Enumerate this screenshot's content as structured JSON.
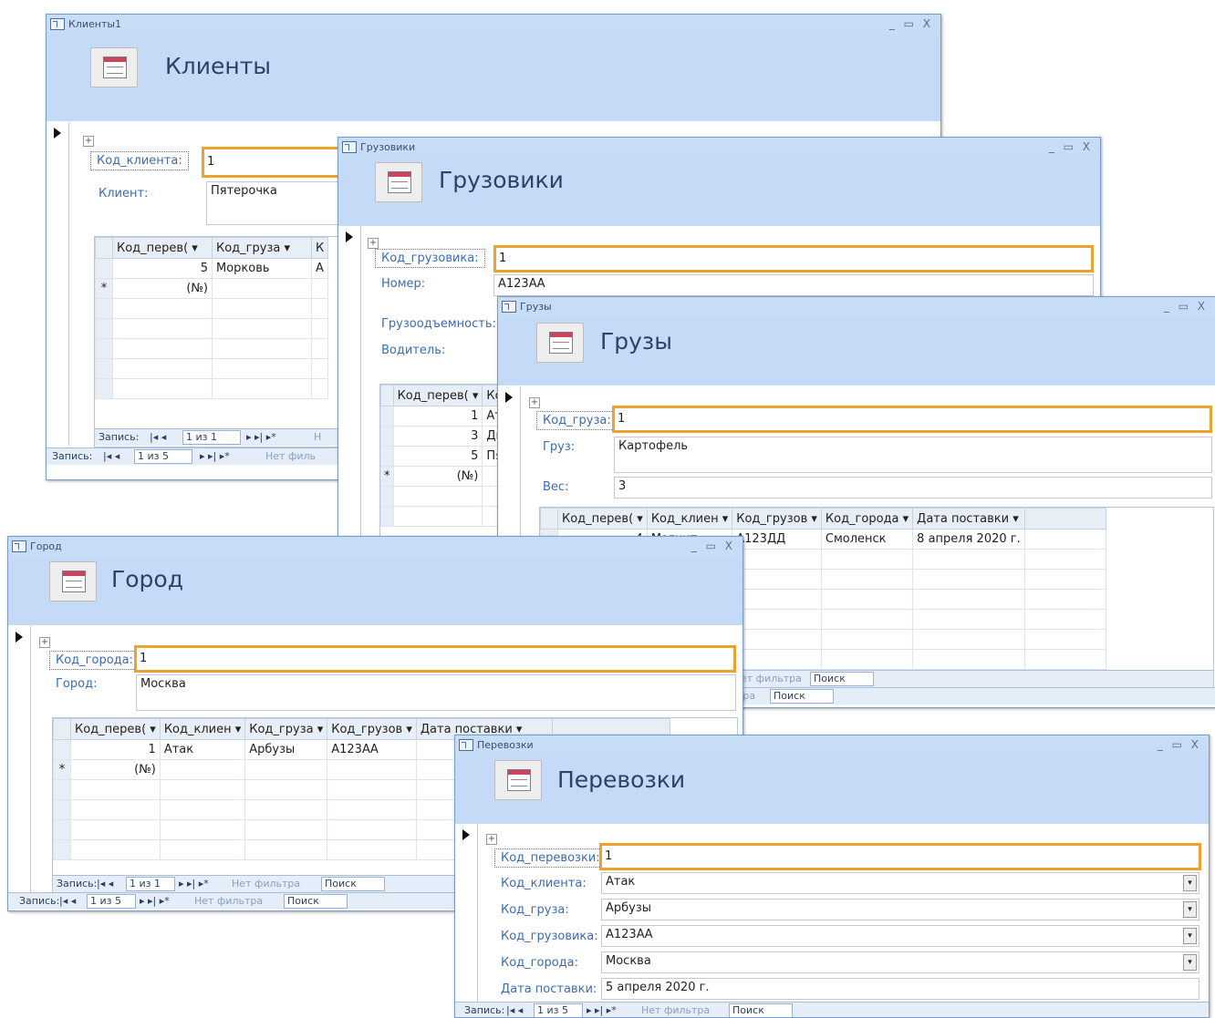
{
  "clients": {
    "title": "Клиенты1",
    "header": "Клиенты",
    "controls": "_ ▭ X",
    "fields": {
      "code_label": "Код_клиента:",
      "code_value": "1",
      "client_label": "Клиент:",
      "client_value": "Пятерочка"
    },
    "grid": {
      "headers": [
        "Код_перев( ▾",
        "Код_груза ▾",
        "К"
      ],
      "rows": [
        [
          "5",
          "Морковь",
          "А"
        ]
      ],
      "new_row": [
        "*",
        "(№)"
      ]
    },
    "inner_nav": {
      "label": "Запись:",
      "record": "1 из 1",
      "filter": "Н"
    },
    "outer_nav": {
      "label": "Запись:",
      "record": "1 из 5",
      "filter": "Нет филь"
    }
  },
  "trucks": {
    "title": "Грузовики",
    "header": "Грузовики",
    "controls": "_ ▭ X",
    "fields": {
      "code_label": "Код_грузовика:",
      "code_value": "1",
      "number_label": "Номер:",
      "number_value": "А123АА",
      "capacity_label": "Грузоодъемность:",
      "driver_label": "Водитель:"
    },
    "grid": {
      "headers": [
        "Код_перев( ▾",
        "Ко"
      ],
      "rows": [
        [
          "1",
          "Ат"
        ],
        [
          "3",
          "Ди"
        ],
        [
          "5",
          "Пя"
        ]
      ],
      "new_row": [
        "*",
        "(№)"
      ]
    }
  },
  "cargo": {
    "title": "Грузы",
    "header": "Грузы",
    "controls": "_ ▭ X",
    "fields": {
      "code_label": "Код_груза:",
      "code_value": "1",
      "cargo_label": "Груз:",
      "cargo_value": "Картофель",
      "weight_label": "Вес:",
      "weight_value": "3"
    },
    "grid": {
      "headers": [
        "Код_перев( ▾",
        "Код_клиен ▾",
        "Код_грузов ▾",
        "Код_города ▾",
        "Дата поставки ▾"
      ],
      "rows": [
        [
          "4",
          "Магнит",
          "А123ДД",
          "Смоленск",
          "8 апреля 2020 г."
        ]
      ]
    },
    "inner_nav": {
      "filter": "ет фильтра",
      "search": "Поиск"
    },
    "outer_nav": {
      "filter": "тра",
      "search": "Поиск"
    }
  },
  "city": {
    "title": "Город",
    "header": "Город",
    "controls": "_ ▭ X",
    "fields": {
      "code_label": "Код_города:",
      "code_value": "1",
      "city_label": "Город:",
      "city_value": "Москва"
    },
    "grid": {
      "headers": [
        "Код_перев( ▾",
        "Код_клиен ▾",
        "Код_груза ▾",
        "Код_грузов ▾",
        "Дата поставки ▾"
      ],
      "rows": [
        [
          "1",
          "Атак",
          "Арбузы",
          "А123АА",
          ""
        ]
      ],
      "new_row": [
        "*",
        "(№)"
      ]
    },
    "inner_nav": {
      "label": "Запись:",
      "record": "1 из 1",
      "filter": "Нет фильтра",
      "search": "Поиск"
    },
    "outer_nav": {
      "label": "Запись:",
      "record": "1 из 5",
      "filter": "Нет фильтра",
      "search": "Поиск"
    }
  },
  "transport": {
    "title": "Перевозки",
    "header": "Перевозки",
    "controls": "_ ▭ X",
    "fields": {
      "code_label": "Код_перевозки:",
      "code_value": "1",
      "client_label": "Код_клиента:",
      "client_value": "Атак",
      "cargo_label": "Код_груза:",
      "cargo_value": "Арбузы",
      "truck_label": "Код_грузовика:",
      "truck_value": "А123АА",
      "city_label": "Код_города:",
      "city_value": "Москва",
      "date_label": "Дата поставки:",
      "date_value": "5 апреля 2020 г."
    },
    "nav": {
      "label": "Запись:",
      "record": "1 из 5",
      "filter": "Нет фильтра",
      "search": "Поиск"
    }
  }
}
